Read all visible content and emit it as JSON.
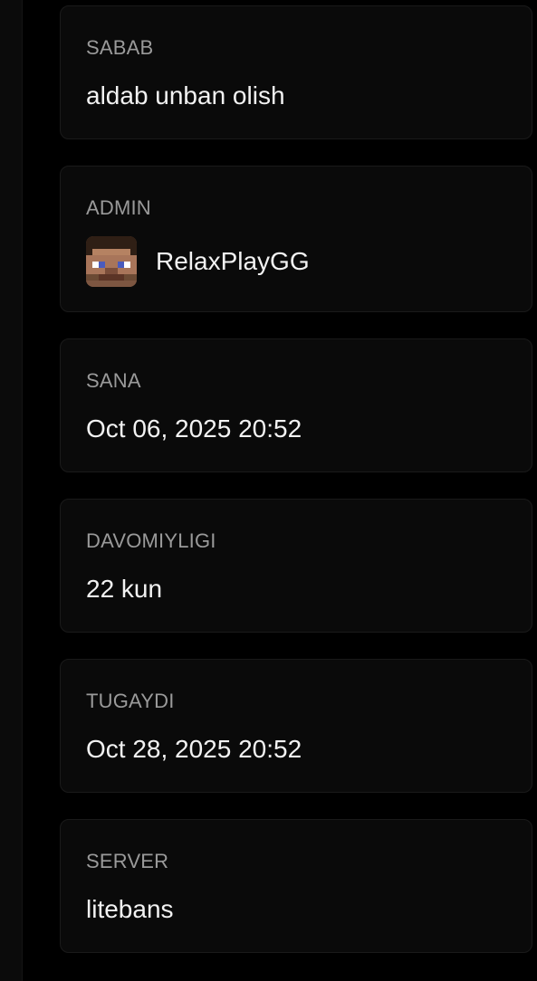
{
  "details": {
    "reason": {
      "label": "SABAB",
      "value": "aldab unban olish"
    },
    "admin": {
      "label": "ADMIN",
      "name": "RelaxPlayGG",
      "avatar_icon": "minecraft-steve-head-icon"
    },
    "date": {
      "label": "SANA",
      "value": "Oct 06, 2025 20:52"
    },
    "duration": {
      "label": "DAVOMIYLIGI",
      "value": "22 kun"
    },
    "expires": {
      "label": "TUGAYDI",
      "value": "Oct 28, 2025 20:52"
    },
    "server": {
      "label": "SERVER",
      "value": "litebans"
    }
  },
  "colors": {
    "background": "#000000",
    "card": "#0a0a0a",
    "card_border": "#1a1a1a",
    "label": "#9a9a9a",
    "value": "#f2f2f2"
  }
}
